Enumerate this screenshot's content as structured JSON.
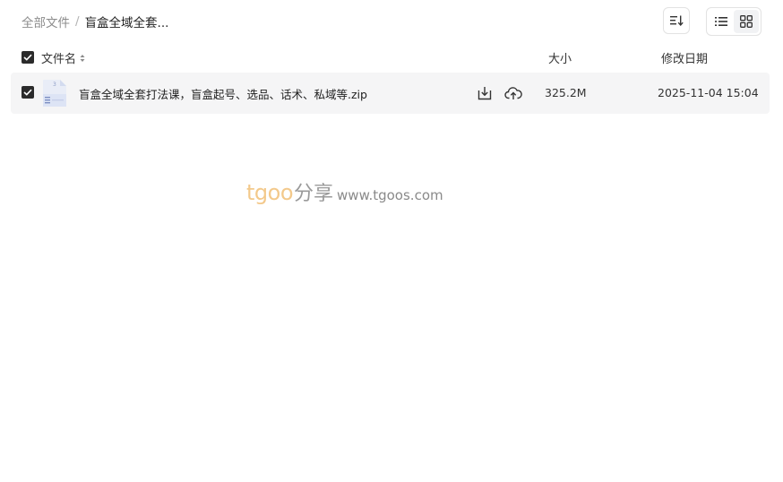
{
  "breadcrumb": {
    "root": "全部文件",
    "separator": "/",
    "current": "盲盒全域全套..."
  },
  "toolbar": {
    "sort_icon": "sort-list-icon",
    "view_list_icon": "list-view-icon",
    "view_grid_icon": "grid-view-icon",
    "active_view": "grid"
  },
  "table": {
    "headers": {
      "name": "文件名",
      "size": "大小",
      "date": "修改日期"
    },
    "rows": [
      {
        "icon": "zip-file-icon",
        "name": "盲盒全域全套打法课，盲盒起号、选品、话术、私域等.zip",
        "size": "325.2M",
        "date": "2025-11-04 15:04",
        "checked": true
      }
    ]
  },
  "watermark": {
    "brand": "tgoo",
    "share": "分享",
    "url": "www.tgoos.com"
  },
  "colors": {
    "row_background": "#f5f5f6",
    "checkbox": "#2b2b2b",
    "watermark_brand": "#f3c98b",
    "watermark_text": "#9a9a9a"
  }
}
